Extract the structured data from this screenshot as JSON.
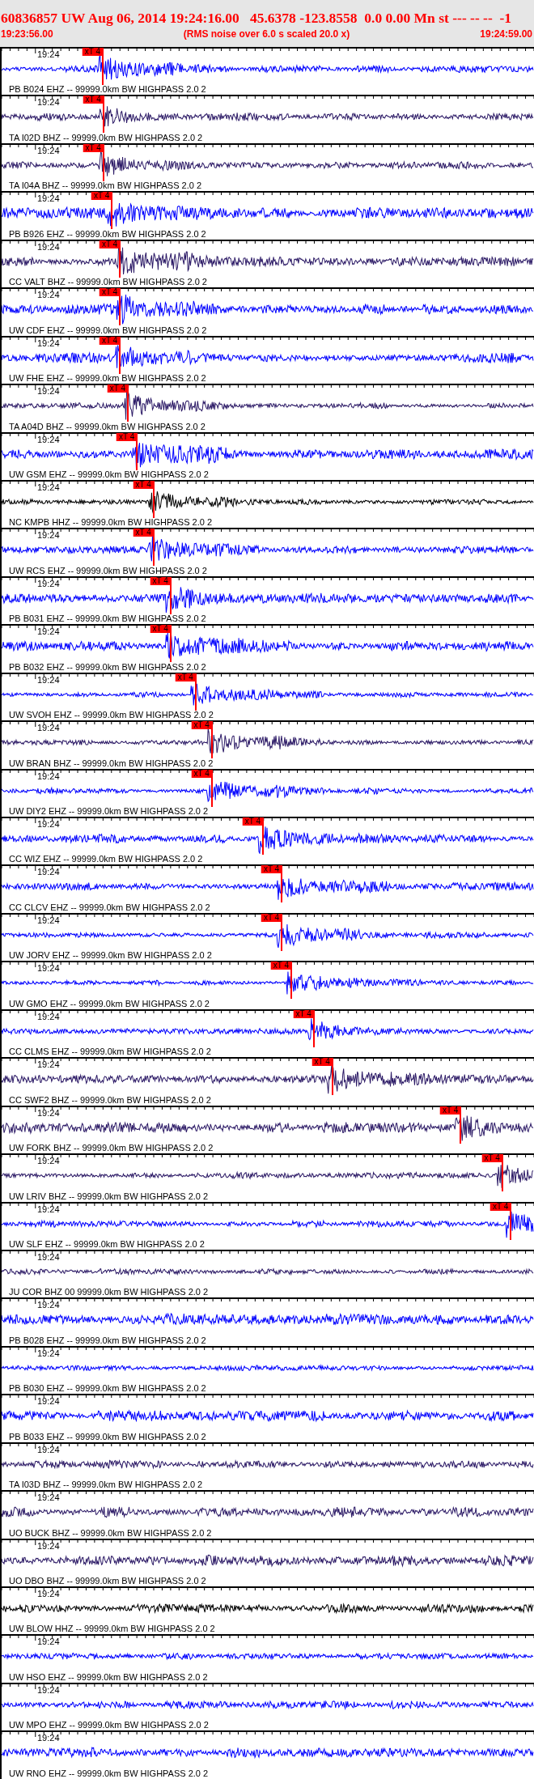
{
  "header": {
    "title": "60836857 UW Aug 06, 2014 19:24:16.00   45.6378 -123.8558  0.0 0.00 Mn st --- -- --  -1",
    "start": "19:23:56.00",
    "caption": "(RMS noise over 6.0 s scaled 20.0 x)",
    "end": "19:24:59.00"
  },
  "traces": [
    {
      "time_label": "19:24",
      "pick": {
        "label": "xT 4"
      },
      "color": "#0000ff",
      "label": "PB B024 EHZ -- 99999.0km BW HIGHPASS 2.0 2"
    },
    {
      "time_label": "19:24",
      "pick": {
        "label": "xT 4"
      },
      "color": "#2c1a66",
      "label": "TA I02D BHZ -- 99999.0km BW HIGHPASS 2.0 2"
    },
    {
      "time_label": "19:24",
      "pick": {
        "label": "xT 4"
      },
      "color": "#2c1a66",
      "label": "TA I04A BHZ -- 99999.0km BW HIGHPASS 2.0 2"
    },
    {
      "time_label": "19:24",
      "pick": {
        "label": "xT 4"
      },
      "color": "#0000ff",
      "label": "PB B926 EHZ -- 99999.0km BW HIGHPASS 2.0 2"
    },
    {
      "time_label": "19:24",
      "pick": {
        "label": "xT 4"
      },
      "color": "#2c1a66",
      "label": "CC VALT BHZ -- 99999.0km BW HIGHPASS 2.0 2"
    },
    {
      "time_label": "19:24",
      "pick": {
        "label": "xT 4"
      },
      "color": "#0000ff",
      "label": "UW CDF EHZ -- 99999.0km BW HIGHPASS 2.0 2"
    },
    {
      "time_label": "19:24",
      "pick": {
        "label": "xT 4"
      },
      "color": "#0000ff",
      "label": "UW FHE EHZ -- 99999.0km BW HIGHPASS 2.0 2"
    },
    {
      "time_label": "19:24",
      "pick": {
        "label": "xT 4"
      },
      "color": "#2c1a66",
      "label": "TA A04D BHZ -- 99999.0km BW HIGHPASS 2.0 2"
    },
    {
      "time_label": "19:24",
      "pick": {
        "label": "xT 4"
      },
      "color": "#0000ff",
      "label": "UW GSM EHZ -- 99999.0km BW HIGHPASS 2.0 2"
    },
    {
      "time_label": "19:24",
      "pick": {
        "label": "xT 4"
      },
      "color": "#000000",
      "label": "NC KMPB HHZ -- 99999.0km BW HIGHPASS 2.0 2"
    },
    {
      "time_label": "19:24",
      "pick": {
        "label": "xT 4"
      },
      "color": "#0000ff",
      "label": "UW RCS EHZ -- 99999.0km BW HIGHPASS 2.0 2"
    },
    {
      "time_label": "19:24",
      "pick": {
        "label": "xT 4"
      },
      "color": "#0000ff",
      "label": "PB B031 EHZ -- 99999.0km BW HIGHPASS 2.0 2"
    },
    {
      "time_label": "19:24",
      "pick": {
        "label": "xT 4"
      },
      "color": "#0000ff",
      "label": "PB B032 EHZ -- 99999.0km BW HIGHPASS 2.0 2"
    },
    {
      "time_label": "19:24",
      "pick": {
        "label": "xT 4"
      },
      "color": "#0000ff",
      "label": "UW SVOH EHZ -- 99999.0km BW HIGHPASS 2.0 2"
    },
    {
      "time_label": "19:24",
      "pick": {
        "label": "xT 4"
      },
      "color": "#2c1a66",
      "label": "UW BRAN BHZ -- 99999.0km BW HIGHPASS 2.0 2"
    },
    {
      "time_label": "19:24",
      "pick": {
        "label": "xT 4"
      },
      "color": "#0000ff",
      "label": "UW DIY2 EHZ -- 99999.0km BW HIGHPASS 2.0 2"
    },
    {
      "time_label": "19:24",
      "pick": {
        "label": "xT 4"
      },
      "color": "#0000ff",
      "label": "CC WIZ EHZ -- 99999.0km BW HIGHPASS 2.0 2"
    },
    {
      "time_label": "19:24",
      "pick": {
        "label": "xT 4"
      },
      "color": "#0000ff",
      "label": "CC CLCV EHZ -- 99999.0km BW HIGHPASS 2.0 2"
    },
    {
      "time_label": "19:24",
      "pick": {
        "label": "xT 4"
      },
      "color": "#0000ff",
      "label": "UW JORV EHZ -- 99999.0km BW HIGHPASS 2.0 2"
    },
    {
      "time_label": "19:24",
      "pick": {
        "label": "xT 4"
      },
      "color": "#0000ff",
      "label": "UW GMO EHZ -- 99999.0km BW HIGHPASS 2.0 2"
    },
    {
      "time_label": "19:24",
      "pick": {
        "label": "xT 4"
      },
      "color": "#0000ff",
      "label": "CC CLMS EHZ -- 99999.0km BW HIGHPASS 2.0 2"
    },
    {
      "time_label": "19:24",
      "pick": {
        "label": "xT 4"
      },
      "color": "#2c1a66",
      "label": "CC SWF2 BHZ -- 99999.0km BW HIGHPASS 2.0 2"
    },
    {
      "time_label": "19:24",
      "pick": {
        "label": "xT 4"
      },
      "color": "#2c1a66",
      "label": "UW FORK BHZ -- 99999.0km BW HIGHPASS 2.0 2"
    },
    {
      "time_label": "19:24",
      "pick": {
        "label": "xT 4"
      },
      "color": "#2c1a66",
      "label": "UW LRIV BHZ -- 99999.0km BW HIGHPASS 2.0 2"
    },
    {
      "time_label": "19:24",
      "pick": {
        "label": "xT 4"
      },
      "color": "#0000ff",
      "label": "UW SLF EHZ -- 99999.0km BW HIGHPASS 2.0 2"
    },
    {
      "time_label": "19:24",
      "color": "#2c1a66",
      "label": "JU COR BHZ 00 99999.0km BW HIGHPASS 2.0 2"
    },
    {
      "time_label": "19:24",
      "color": "#0000ff",
      "label": "PB B028 EHZ -- 99999.0km BW HIGHPASS 2.0 2"
    },
    {
      "time_label": "19:24",
      "color": "#0000ff",
      "label": "PB B030 EHZ -- 99999.0km BW HIGHPASS 2.0 2"
    },
    {
      "time_label": "19:24",
      "color": "#0000ff",
      "label": "PB B033 EHZ -- 99999.0km BW HIGHPASS 2.0 2"
    },
    {
      "time_label": "19:24",
      "color": "#2c1a66",
      "label": "TA I03D BHZ -- 99999.0km BW HIGHPASS 2.0 2"
    },
    {
      "time_label": "19:24",
      "color": "#2c1a66",
      "label": "UO BUCK BHZ -- 99999.0km BW HIGHPASS 2.0 2"
    },
    {
      "time_label": "19:24",
      "color": "#2c1a66",
      "label": "UO DBO BHZ -- 99999.0km BW HIGHPASS 2.0 2"
    },
    {
      "time_label": "19:24",
      "color": "#000000",
      "label": "UW BLOW HHZ -- 99999.0km BW HIGHPASS 2.0 2"
    },
    {
      "time_label": "19:24",
      "color": "#0000ff",
      "label": "UW HSO EHZ -- 99999.0km BW HIGHPASS 2.0 2"
    },
    {
      "time_label": "19:24",
      "color": "#0000ff",
      "label": "UW MPO EHZ -- 99999.0km BW HIGHPASS 2.0 2"
    },
    {
      "time_label": "19:24",
      "color": "#0000ff",
      "label": "UW RNO EHZ -- 99999.0km BW HIGHPASS 2.0 2"
    }
  ]
}
